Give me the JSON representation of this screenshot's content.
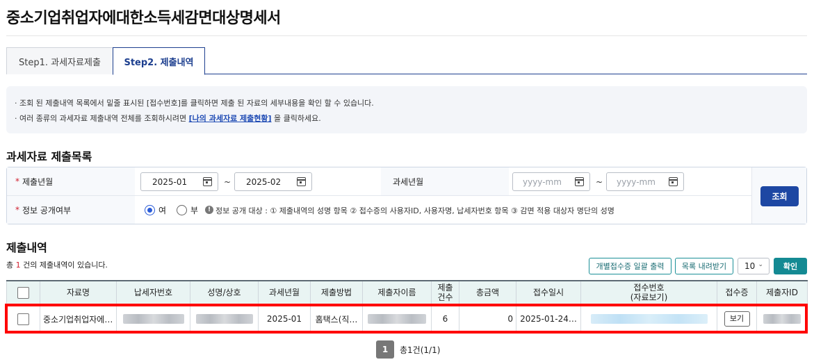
{
  "page": {
    "title": "중소기업취업자에대한소득세감면대상명세서",
    "tabs": [
      {
        "label": "Step1. 과세자료제출",
        "active": false
      },
      {
        "label": "Step2. 제출내역",
        "active": true
      }
    ]
  },
  "info": {
    "line1": "· 조회 된 제출내역 목록에서 밑줄 표시된 [접수번호]를 클릭하면 제출 된 자료의 세부내용을 확인 할 수 있습니다.",
    "line2_pre": "· 여러 종류의 과세자료 제출내역 전체를 조회하시려면 ",
    "line2_link": "[나의 과세자료 제출현황]",
    "line2_post": " 을 클릭하세요."
  },
  "search": {
    "section_title": "과세자료 제출목록",
    "required_mark": "*",
    "submit_month_label": "제출년월",
    "submit_from": "2025-01",
    "submit_to": "2025-02",
    "tilde": "~",
    "tax_month_label": "과세년월",
    "tax_from_placeholder": "yyyy-mm",
    "tax_to_placeholder": "yyyy-mm",
    "disclosure_label": "정보 공개여부",
    "option_yes": "여",
    "option_no": "부",
    "selected": "여",
    "note_icon": "!",
    "note": "정보 공개 대상 : ① 제출내역의 성명 항목 ② 접수증의 사용자ID, 사용자명, 납세자번호 항목 ③ 감면 적용 대상자 명단의 성명",
    "search_button": "조회"
  },
  "results": {
    "section_title": "제출내역",
    "count_pre": "총 ",
    "count": "1",
    "count_post": " 건의 제출내역이 있습니다.",
    "btn_print_receipts": "개별접수증 일괄 출력",
    "btn_download_list": "목록 내려받기",
    "page_size": "10",
    "btn_confirm": "확인",
    "columns": [
      "자료명",
      "납세자번호",
      "성명/상호",
      "과세년월",
      "제출방법",
      "제출자이름",
      "제출\n건수",
      "총금액",
      "접수일시",
      "접수번호\n(자료보기)",
      "접수증",
      "제출자ID"
    ],
    "rows": [
      {
        "data_name": "중소기업취업자에…",
        "tax_month": "2025-01",
        "method": "홈택스(직…",
        "count": "6",
        "total": "0",
        "received_at": "2025-01-24…",
        "receipt_button": "보기"
      }
    ]
  },
  "pagination": {
    "current": "1",
    "summary": "총1건(1/1)"
  },
  "colors": {
    "primary": "#1d47a3",
    "teal": "#148a93",
    "highlight": "#ff0000",
    "required": "#d01f2f"
  }
}
